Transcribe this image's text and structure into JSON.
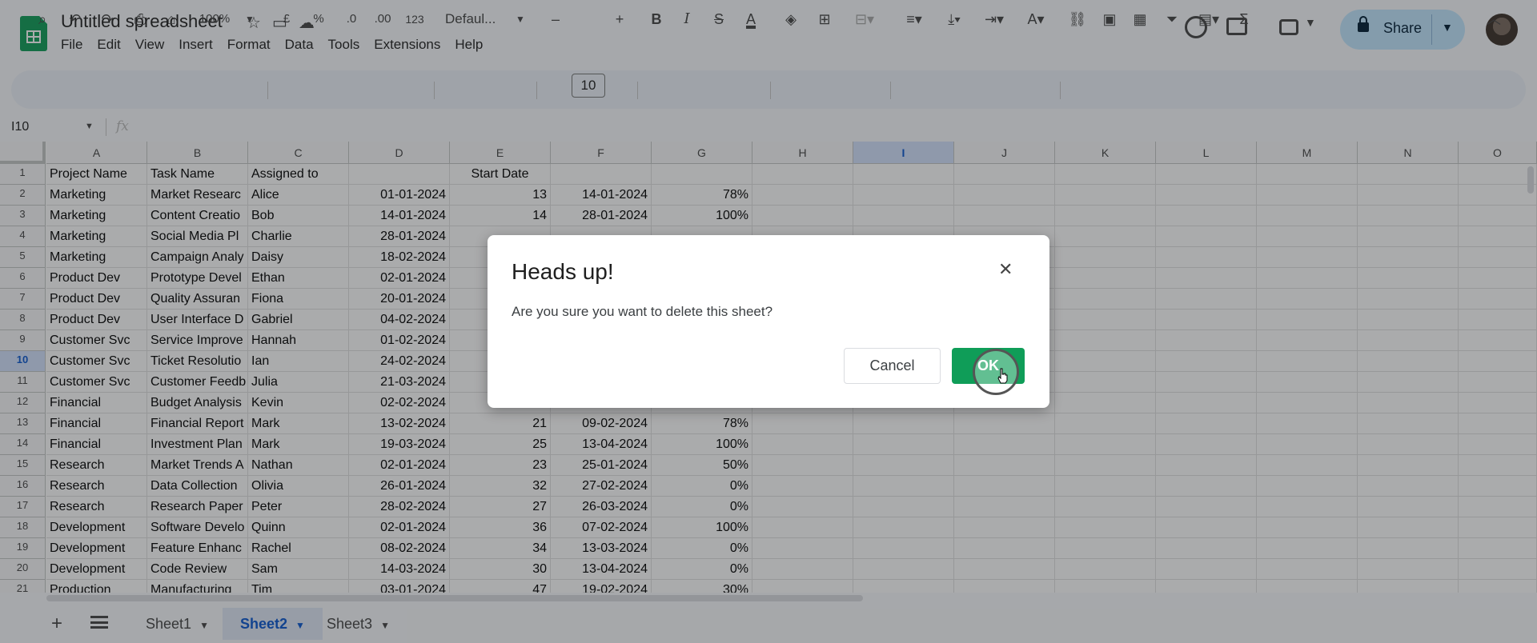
{
  "header": {
    "doc_title": "Untitled spreadsheet",
    "menu": [
      "File",
      "Edit",
      "View",
      "Insert",
      "Format",
      "Data",
      "Tools",
      "Extensions",
      "Help"
    ],
    "share_label": "Share"
  },
  "toolbar": {
    "zoom": "100%",
    "currency": "£",
    "percent": "%",
    "dec_decrease": ".0",
    "dec_increase": ".00",
    "number_format": "123",
    "font": "Defaul...",
    "font_size": "10",
    "bold": "B",
    "italic": "I",
    "strike": "S",
    "text_color": "A",
    "text_color_accent": "#000000"
  },
  "formula_bar": {
    "cell_ref": "I10",
    "fx": "fx"
  },
  "grid": {
    "columns": [
      "A",
      "B",
      "C",
      "D",
      "E",
      "F",
      "G",
      "H",
      "I",
      "J",
      "K",
      "L",
      "M",
      "N",
      "O"
    ],
    "selected_column": "I",
    "selected_row": 10,
    "rows": [
      [
        "Project Name",
        "Task Name",
        "Assigned to",
        "",
        "Start Date",
        "",
        ""
      ],
      [
        "Marketing",
        "Market Researc",
        "Alice",
        "01-01-2024",
        "13",
        "14-01-2024",
        "78%"
      ],
      [
        "Marketing",
        "Content Creatio",
        "Bob",
        "14-01-2024",
        "14",
        "28-01-2024",
        "100%"
      ],
      [
        "Marketing",
        "Social Media Pl",
        "Charlie",
        "28-01-2024",
        "",
        "",
        ""
      ],
      [
        "Marketing",
        "Campaign Analy",
        "Daisy",
        "18-02-2024",
        "",
        "",
        ""
      ],
      [
        "Product Dev",
        "Prototype Devel",
        "Ethan",
        "02-01-2024",
        "",
        "",
        ""
      ],
      [
        "Product Dev",
        "Quality Assuran",
        "Fiona",
        "20-01-2024",
        "",
        "",
        ""
      ],
      [
        "Product Dev",
        "User Interface D",
        "Gabriel",
        "04-02-2024",
        "",
        "",
        ""
      ],
      [
        "Customer Svc",
        "Service Improve",
        "Hannah",
        "01-02-2024",
        "",
        "",
        ""
      ],
      [
        "Customer Svc",
        "Ticket Resolutio",
        "Ian",
        "24-02-2024",
        "",
        "",
        ""
      ],
      [
        "Customer Svc",
        "Customer Feedb",
        "Julia",
        "21-03-2024",
        "",
        "",
        ""
      ],
      [
        "Financial",
        "Budget Analysis",
        "Kevin",
        "02-02-2024",
        "",
        "",
        ""
      ],
      [
        "Financial",
        "Financial Report",
        "Mark",
        "13-02-2024",
        "21",
        "09-02-2024",
        "78%"
      ],
      [
        "Financial",
        "Investment Plan",
        "Mark",
        "19-03-2024",
        "25",
        "13-04-2024",
        "100%"
      ],
      [
        "Research",
        "Market Trends A",
        "Nathan",
        "02-01-2024",
        "23",
        "25-01-2024",
        "50%"
      ],
      [
        "Research",
        "Data Collection",
        "Olivia",
        "26-01-2024",
        "32",
        "27-02-2024",
        "0%"
      ],
      [
        "Research",
        "Research Paper",
        "Peter",
        "28-02-2024",
        "27",
        "26-03-2024",
        "0%"
      ],
      [
        "Development",
        "Software Develo",
        "Quinn",
        "02-01-2024",
        "36",
        "07-02-2024",
        "100%"
      ],
      [
        "Development",
        "Feature Enhanc",
        "Rachel",
        "08-02-2024",
        "34",
        "13-03-2024",
        "0%"
      ],
      [
        "Development",
        "Code Review",
        "Sam",
        "14-03-2024",
        "30",
        "13-04-2024",
        "0%"
      ],
      [
        "Production",
        "Manufacturing",
        "Tim",
        "03-01-2024",
        "47",
        "19-02-2024",
        "30%"
      ]
    ]
  },
  "sheets": {
    "tabs": [
      "Sheet1",
      "Sheet2",
      "Sheet3"
    ],
    "active": "Sheet2"
  },
  "dialog": {
    "title": "Heads up!",
    "message": "Are you sure you want to delete this sheet?",
    "cancel_label": "Cancel",
    "ok_label": "OK",
    "close_glyph": "✕"
  },
  "colors": {
    "ok_button": "#0f9d58",
    "share_button": "#c2e7ff",
    "selected_header": "#d3e3fd"
  }
}
